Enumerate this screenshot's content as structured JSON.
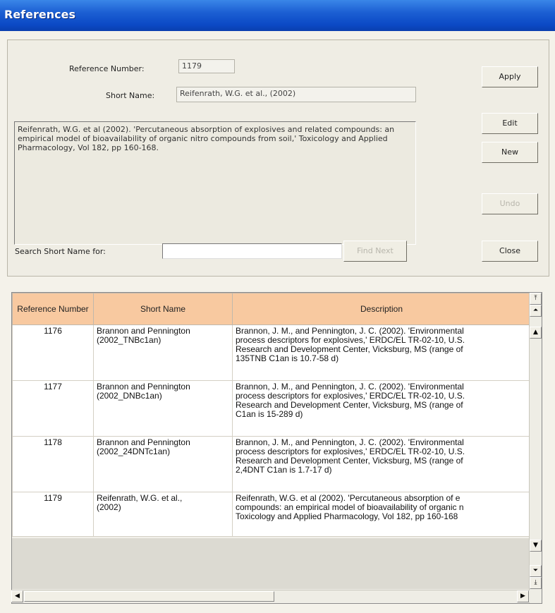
{
  "window": {
    "title": "References"
  },
  "form": {
    "ref_number_label": "Reference Number:",
    "ref_number_value": "1179",
    "short_name_label": "Short Name:",
    "short_name_value": "Reifenrath, W.G. et al., (2002)",
    "description_value": "Reifenrath, W.G. et al (2002). 'Percutaneous absorption of explosives and related compounds: an empirical model of bioavailability of organic nitro compounds from soil,' Toxicology and Applied Pharmacology, Vol 182, pp 160-168.",
    "search_label": "Search Short Name for:",
    "search_value": "",
    "find_next_label": "Find Next"
  },
  "buttons": {
    "apply": "Apply",
    "edit": "Edit",
    "new": "New",
    "undo": "Undo",
    "close": "Close"
  },
  "grid": {
    "headers": [
      "Reference Number",
      "Short Name",
      "Description"
    ],
    "rows": [
      {
        "number": "1176",
        "short_name": [
          "Brannon and Pennington",
          "(2002_TNBc1an)"
        ],
        "description": [
          "Brannon, J. M., and Pennington, J. C. (2002). 'Environmental",
          "process descriptors for explosives,' ERDC/EL TR-02-10, U.S.",
          "Research and Development Center, Vicksburg, MS (range of",
          "135TNB C1an is 10.7-58 d)"
        ]
      },
      {
        "number": "1177",
        "short_name": [
          "Brannon and Pennington",
          "(2002_DNBc1an)"
        ],
        "description": [
          "Brannon, J. M., and Pennington, J. C. (2002). 'Environmental",
          "process descriptors for explosives,' ERDC/EL TR-02-10, U.S.",
          "Research and Development Center, Vicksburg, MS (range of",
          "C1an is 15-289 d)"
        ]
      },
      {
        "number": "1178",
        "short_name": [
          "Brannon and Pennington",
          "(2002_24DNTc1an)"
        ],
        "description": [
          "Brannon, J. M., and Pennington, J. C. (2002). 'Environmental",
          "process descriptors for explosives,' ERDC/EL TR-02-10, U.S.",
          "Research and Development Center, Vicksburg, MS (range of",
          "2,4DNT C1an is 1.7-17 d)"
        ]
      },
      {
        "number": "1179",
        "short_name": [
          "Reifenrath, W.G. et al.,",
          "(2002)"
        ],
        "description": [
          "Reifenrath, W.G. et al (2002). 'Percutaneous absorption of e",
          "compounds: an empirical model of bioavailability of organic n",
          "Toxicology and Applied Pharmacology, Vol 182, pp 160-168"
        ]
      }
    ]
  }
}
